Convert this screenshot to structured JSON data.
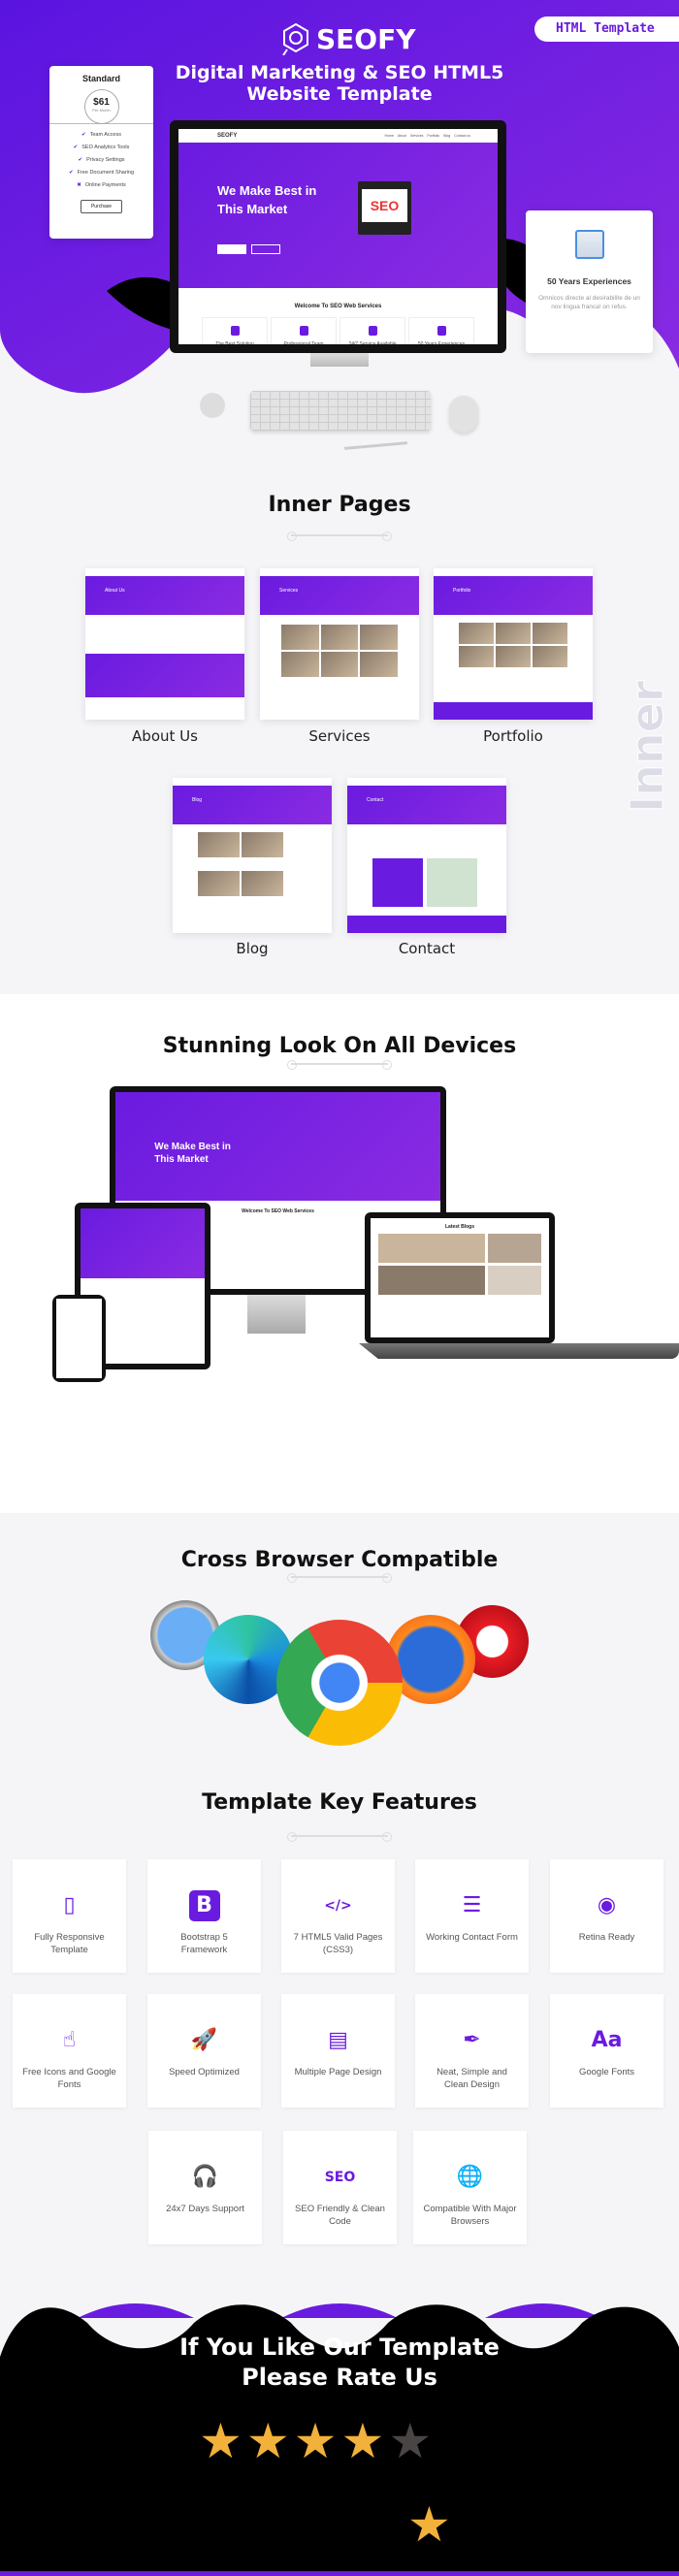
{
  "hero": {
    "badge": "HTML Template",
    "logo_text": "SEOFY",
    "title_line1": "Digital Marketing & SEO HTML5",
    "title_line2": "Website Template",
    "brand_color": "#6a1be0"
  },
  "pricing_card": {
    "plan": "Standard",
    "price": "$61",
    "period": "Per Month",
    "features": [
      {
        "label": "Team Access",
        "included": true
      },
      {
        "label": "SEO Analytics Tools",
        "included": true
      },
      {
        "label": "Privacy Settings",
        "included": true
      },
      {
        "label": "Free Document Sharing",
        "included": true
      },
      {
        "label": "Online Payments",
        "included": false
      }
    ],
    "button": "Purchase"
  },
  "experience_card": {
    "title": "50 Years Experiences",
    "text": "Omnicos directe al desirabilite de un nov lingua franca! on refus."
  },
  "mock_site": {
    "logo": "SEOFY",
    "nav": [
      "Home",
      "About",
      "Services",
      "Portfolio",
      "Blog",
      "Contact us"
    ],
    "hero_title_line1": "We Make Best in",
    "hero_title_line2": "This Market",
    "section_title": "Welcome To SEO Web Services",
    "services": [
      "The Best Solution",
      "Professional Team",
      "24/7 Service Available",
      "50 Years Experiences"
    ]
  },
  "inner_pages": {
    "title": "Inner Pages",
    "watermark": "Inner Pages",
    "pages": [
      {
        "label": "About Us",
        "banner": "About Us"
      },
      {
        "label": "Services",
        "banner": "Services"
      },
      {
        "label": "Portfolio",
        "banner": "Portfolio"
      },
      {
        "label": "Blog",
        "banner": "Blog"
      },
      {
        "label": "Contact",
        "banner": "Contact"
      }
    ]
  },
  "devices": {
    "title": "Stunning Look On All Devices",
    "laptop_heading": "Latest Blogs"
  },
  "browsers": {
    "title": "Cross Browser Compatible",
    "items": [
      "safari",
      "edge",
      "chrome",
      "firefox",
      "opera"
    ]
  },
  "features": {
    "title": "Template Key Features",
    "items": [
      {
        "label": "Fully Responsive Template",
        "icon": "devices-icon"
      },
      {
        "label": "Bootstrap 5 Framework",
        "icon": "bootstrap-icon"
      },
      {
        "label": "7 HTML5 Valid Pages (CSS3)",
        "icon": "code-file-icon"
      },
      {
        "label": "Working Contact Form",
        "icon": "form-icon"
      },
      {
        "label": "Retina Ready",
        "icon": "eye-icon"
      },
      {
        "label": "Free Icons and Google Fonts",
        "icon": "touch-icon"
      },
      {
        "label": "Speed Optimized",
        "icon": "rocket-icon"
      },
      {
        "label": "Multiple Page Design",
        "icon": "pages-icon"
      },
      {
        "label": "Neat, Simple and Clean Design",
        "icon": "pen-tool-icon"
      },
      {
        "label": "Google Fonts",
        "icon": "font-icon"
      },
      {
        "label": "24x7 Days Support",
        "icon": "headset-icon"
      },
      {
        "label": "SEO Friendly & Clean Code",
        "icon": "seo-icon"
      },
      {
        "label": "Compatible With Major Browsers",
        "icon": "globe-icon"
      }
    ]
  },
  "rating": {
    "line1": "If You Like Our Template",
    "line2": "Please Rate Us",
    "stars_filled": 4,
    "stars_total": 5,
    "star_color": "#f2b13a"
  }
}
